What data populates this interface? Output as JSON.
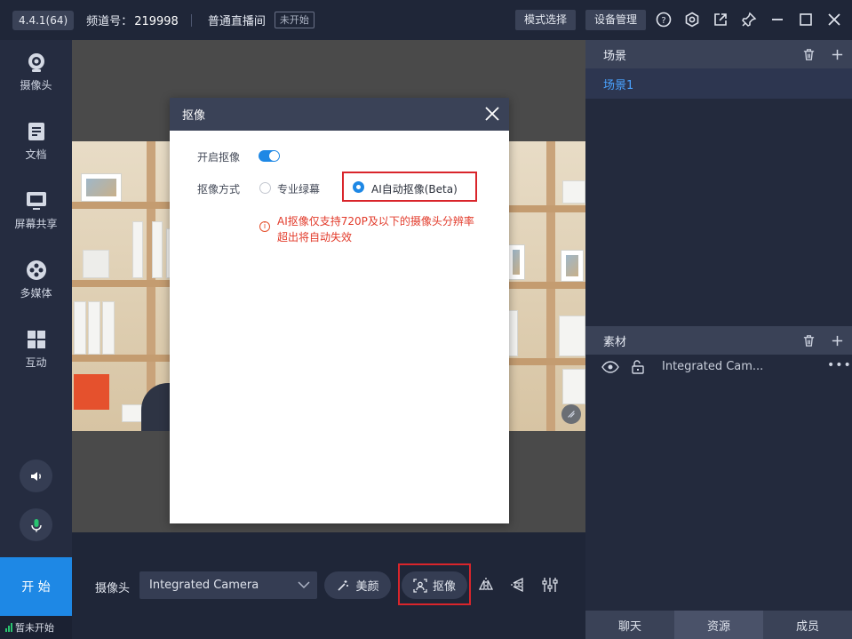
{
  "topbar": {
    "version": "4.4.1(64)",
    "channel_label": "频道号：",
    "channel_number": "219998",
    "room_type": "普通直播间",
    "status": "未开始",
    "mode_button": "模式选择",
    "device_button": "设备管理"
  },
  "nav": {
    "items": [
      {
        "label": "摄像头",
        "icon": "camera-icon"
      },
      {
        "label": "文档",
        "icon": "document-icon"
      },
      {
        "label": "屏幕共享",
        "icon": "screen-share-icon"
      },
      {
        "label": "多媒体",
        "icon": "film-reel-icon"
      },
      {
        "label": "互动",
        "icon": "grid-icon"
      }
    ],
    "start_label": "开 始",
    "net_status": "暂未开始"
  },
  "dialog": {
    "title": "抠像",
    "enable_label": "开启抠像",
    "enable_on": true,
    "mode_label": "抠像方式",
    "option_green": "专业绿幕",
    "option_ai": "AI自动抠像(Beta)",
    "selected": "AI自动抠像(Beta)",
    "warning_line1": "AI抠像仅支持720P及以下的摄像头分辨率",
    "warning_line2": "超出将自动失效"
  },
  "toolbar": {
    "camera_label": "摄像头",
    "camera_value": "Integrated Camera",
    "beauty_label": "美颜",
    "matting_label": "抠像"
  },
  "right_panel": {
    "scenes_title": "场景",
    "scene_item": "场景1",
    "sources_title": "素材",
    "source_item": "Integrated Cam...",
    "tabs": [
      {
        "label": "聊天",
        "active": false
      },
      {
        "label": "资源",
        "active": true
      },
      {
        "label": "成员",
        "active": false
      }
    ]
  },
  "colors": {
    "accent": "#1e88e5",
    "highlight": "#d9252b",
    "warning": "#e23a2a",
    "link": "#4aa3ff"
  }
}
